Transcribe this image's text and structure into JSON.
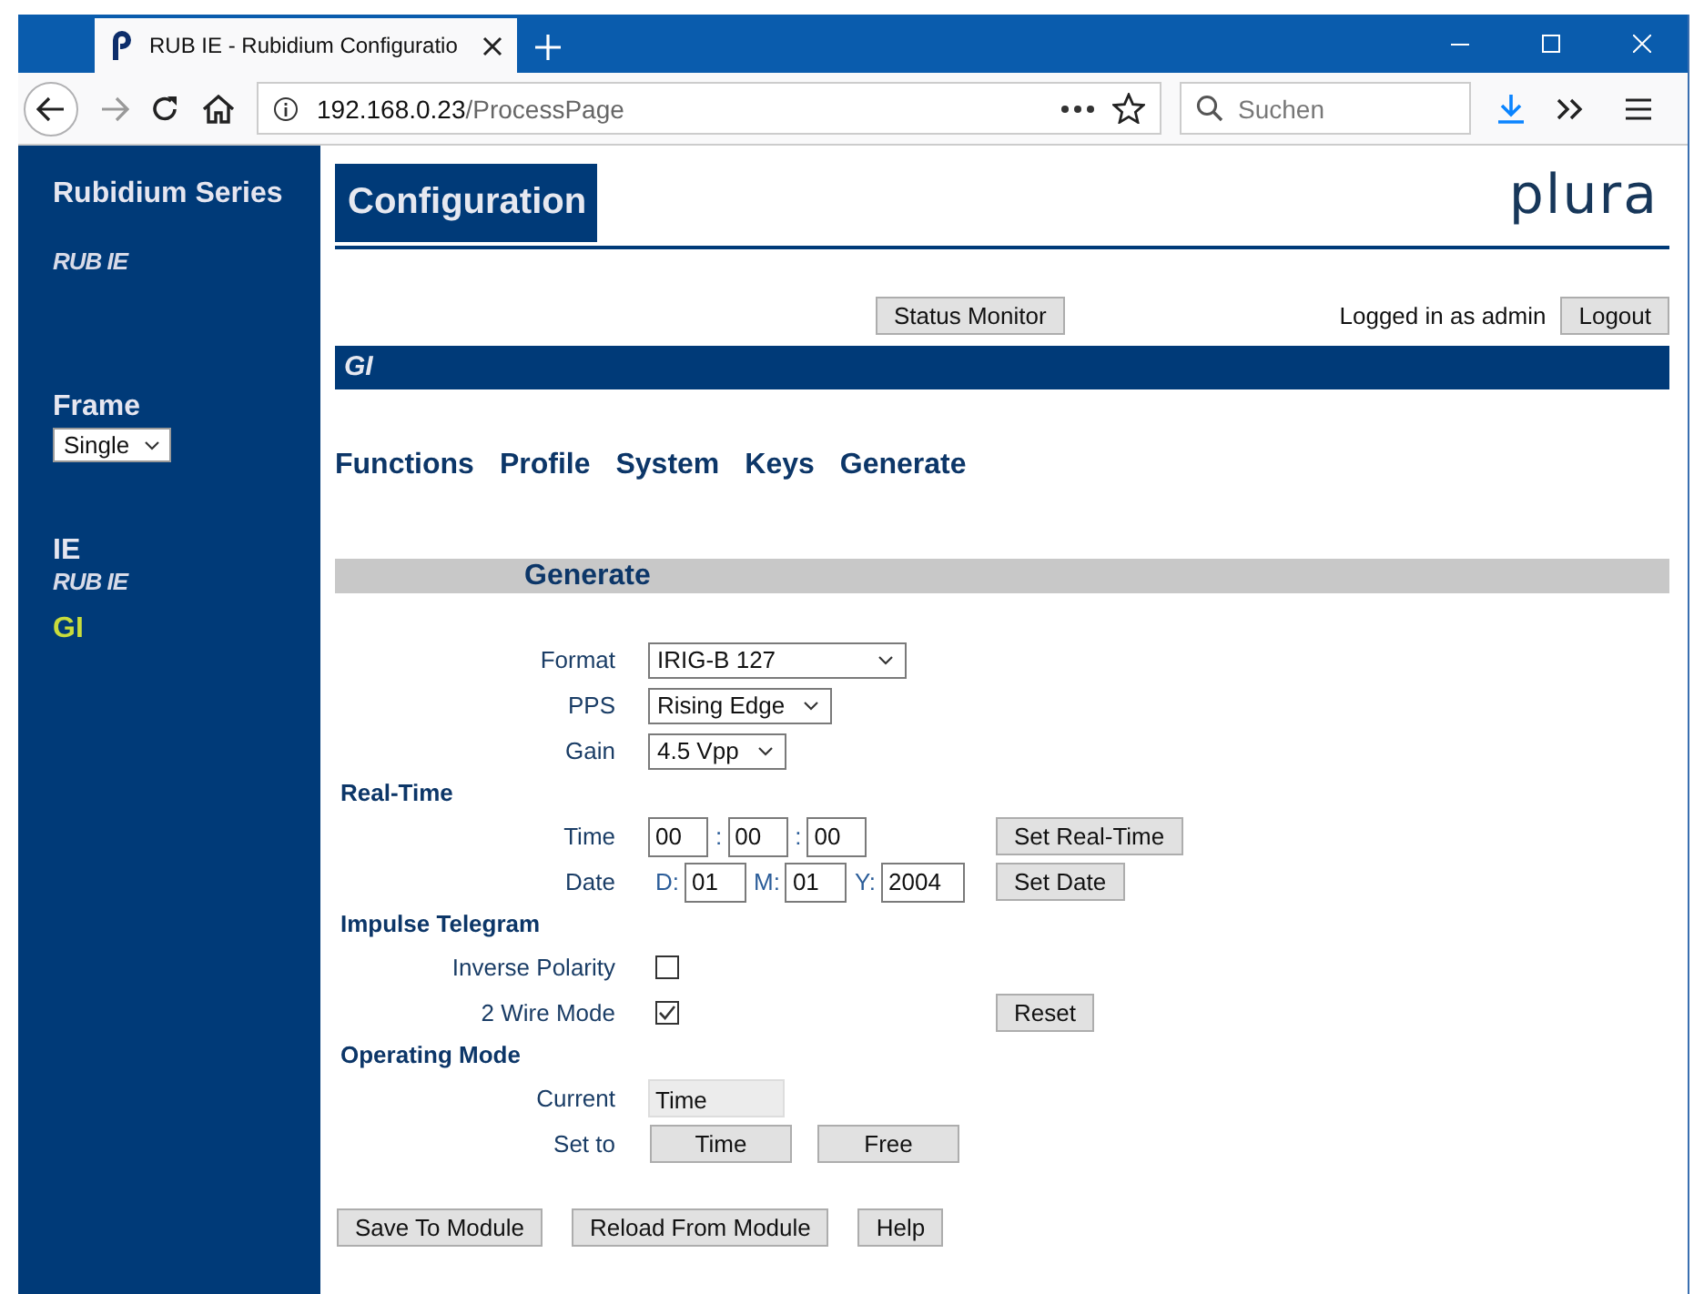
{
  "browser": {
    "tab_title": "RUB IE - Rubidium Configuratio",
    "url_host": "192.168.0.23",
    "url_path": "/ProcessPage",
    "search": {
      "placeholder": "Suchen"
    }
  },
  "sidebar": {
    "title": "Rubidium Series",
    "subtitle": "RUB IE",
    "frame_label": "Frame",
    "frame_select": "Single",
    "module": {
      "name": "IE",
      "model": "RUB IE"
    },
    "items": [
      {
        "label": "GI",
        "selected": true
      }
    ]
  },
  "header": {
    "title": "Configuration",
    "logo": "plura"
  },
  "toolbar": {
    "status_button": "Status Monitor",
    "login_text": "Logged in as admin",
    "logout_button": "Logout"
  },
  "section_bar": "GI",
  "menu": [
    "Functions",
    "Profile",
    "System",
    "Keys",
    "Generate"
  ],
  "panel_title": "Generate",
  "settings": [
    {
      "kind": "select",
      "label": "Format",
      "value": "IRIG-B 127"
    },
    {
      "kind": "select",
      "label": "PPS",
      "value": "Rising Edge"
    },
    {
      "kind": "select",
      "label": "Gain",
      "value": "4.5 Vpp"
    },
    {
      "kind": "heading",
      "label": "Real-Time"
    },
    {
      "kind": "fields",
      "label": "Time",
      "parts": [
        {
          "value": "00"
        },
        {
          "prefix": ":",
          "value": "00"
        },
        {
          "prefix": ":",
          "value": "00"
        }
      ],
      "button": "Set Real-Time"
    },
    {
      "kind": "fields",
      "label": "Date",
      "parts": [
        {
          "prefix": "D:",
          "value": "01"
        },
        {
          "prefix": "M:",
          "value": "01"
        },
        {
          "prefix": "Y:",
          "value": "2004"
        }
      ],
      "button": "Set Date"
    },
    {
      "kind": "heading",
      "label": "Impulse Telegram"
    },
    {
      "kind": "checkbox",
      "label": "Inverse Polarity",
      "checked": false
    },
    {
      "kind": "checkbox",
      "label": "2 Wire Mode",
      "checked": true,
      "button": "Reset"
    },
    {
      "kind": "heading",
      "label": "Operating Mode"
    },
    {
      "kind": "readonly",
      "label": "Current",
      "value": "Time"
    },
    {
      "kind": "buttons",
      "label": "Set to",
      "buttons": [
        "Time",
        "Free"
      ]
    }
  ],
  "footer_buttons": [
    "Save To Module",
    "Reload From Module",
    "Help"
  ]
}
